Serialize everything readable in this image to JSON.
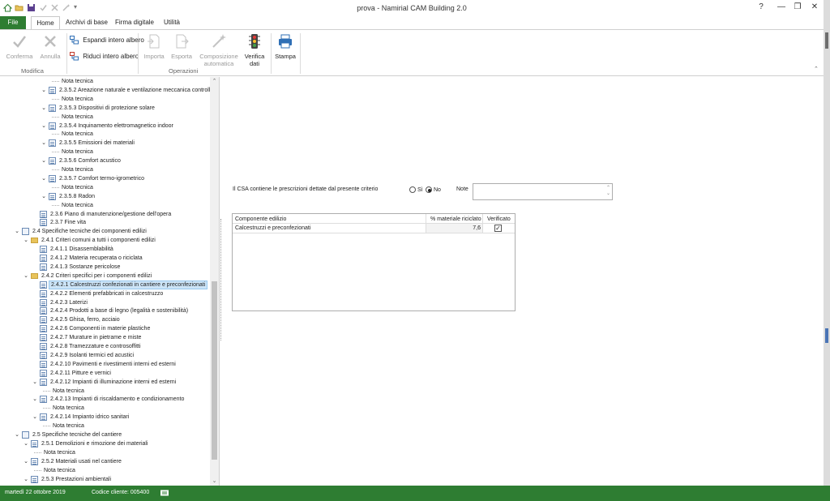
{
  "window": {
    "title": "prova - Namirial CAM Building 2.0",
    "help": "?",
    "minimize": "—",
    "restore": "❐",
    "close": "✕"
  },
  "tabs": [
    "File",
    "Home",
    "Archivi di base",
    "Firma digitale",
    "Utilità"
  ],
  "ribbon": {
    "conferma": "Conferma",
    "annulla": "Annulla",
    "group_modifica": "Modifica",
    "espandi": "Espandi intero albero",
    "riduci": "Riduci intero albero",
    "importa": "Importa",
    "esporta": "Esporta",
    "composizione1": "Composizione",
    "composizione2": "automatica",
    "verifica1": "Verifica",
    "verifica2": "dati",
    "stampa": "Stampa",
    "group_operazioni": "Operazioni"
  },
  "tree": [
    {
      "level": 4,
      "toggle": "",
      "icon": "none",
      "label": "Nota tecnica"
    },
    {
      "level": 3,
      "toggle": "v",
      "icon": "doc",
      "label": "2.3.5.2 Areazione naturale e ventilazione meccanica controllata"
    },
    {
      "level": 4,
      "toggle": "",
      "icon": "none",
      "label": "Nota tecnica"
    },
    {
      "level": 3,
      "toggle": "v",
      "icon": "doc",
      "label": "2.3.5.3 Dispositivi di protezione solare"
    },
    {
      "level": 4,
      "toggle": "",
      "icon": "none",
      "label": "Nota tecnica"
    },
    {
      "level": 3,
      "toggle": "v",
      "icon": "doc",
      "label": "2.3.5.4 Inquinamento elettromagnetico indoor"
    },
    {
      "level": 4,
      "toggle": "",
      "icon": "none",
      "label": "Nota tecnica"
    },
    {
      "level": 3,
      "toggle": "v",
      "icon": "doc",
      "label": "2.3.5.5 Emissioni dei materiali"
    },
    {
      "level": 4,
      "toggle": "",
      "icon": "none",
      "label": "Nota tecnica"
    },
    {
      "level": 3,
      "toggle": "v",
      "icon": "doc",
      "label": "2.3.5.6 Comfort acustico"
    },
    {
      "level": 4,
      "toggle": "",
      "icon": "none",
      "label": "Nota tecnica"
    },
    {
      "level": 3,
      "toggle": "v",
      "icon": "doc",
      "label": "2.3.5.7 Comfort termo-igrometrico"
    },
    {
      "level": 4,
      "toggle": "",
      "icon": "none",
      "label": "Nota tecnica"
    },
    {
      "level": 3,
      "toggle": "v",
      "icon": "doc",
      "label": "2.3.5.8 Radon"
    },
    {
      "level": 4,
      "toggle": "",
      "icon": "none",
      "label": "Nota tecnica"
    },
    {
      "level": 2,
      "toggle": "",
      "icon": "doc",
      "label": "2.3.6 Piano di manutenzione/gestione dell'opera"
    },
    {
      "level": 2,
      "toggle": "",
      "icon": "doc",
      "label": "2.3.7 Fine vita"
    },
    {
      "level": 0,
      "toggle": "v",
      "icon": "sec",
      "label": "2.4 Specifiche tecniche dei componenti edilizi"
    },
    {
      "level": 1,
      "toggle": "v",
      "icon": "folder",
      "label": "2.4.1 Criteri comuni a tutti i componenti edilizi"
    },
    {
      "level": 2,
      "toggle": "",
      "icon": "doc",
      "label": "2.4.1.1 Disassemblabilità"
    },
    {
      "level": 2,
      "toggle": "",
      "icon": "doc",
      "label": "2.4.1.2 Materia recuperata o riciclata"
    },
    {
      "level": 2,
      "toggle": "",
      "icon": "doc",
      "label": "2.4.1.3 Sostanze pericolose"
    },
    {
      "level": 1,
      "toggle": "v",
      "icon": "folder",
      "label": "2.4.2 Criteri specifici per i componenti edilizi"
    },
    {
      "level": 2,
      "toggle": "",
      "icon": "doc",
      "label": "2.4.2.1 Calcestruzzi confezionati in cantiere e preconfezionati",
      "selected": true
    },
    {
      "level": 2,
      "toggle": "",
      "icon": "doc",
      "label": "2.4.2.2 Elementi prefabbricati in calcestruzzo"
    },
    {
      "level": 2,
      "toggle": "",
      "icon": "doc",
      "label": "2.4.2.3 Laterizi"
    },
    {
      "level": 2,
      "toggle": "",
      "icon": "doc",
      "label": "2.4.2.4 Prodotti a base di legno (legalità e sostenibilità)"
    },
    {
      "level": 2,
      "toggle": "",
      "icon": "doc",
      "label": "2.4.2.5 Ghisa, ferro, acciaio"
    },
    {
      "level": 2,
      "toggle": "",
      "icon": "doc",
      "label": "2.4.2.6 Componenti in materie plastiche"
    },
    {
      "level": 2,
      "toggle": "",
      "icon": "doc",
      "label": "2.4.2.7 Murature in pietrame e miste"
    },
    {
      "level": 2,
      "toggle": "",
      "icon": "doc",
      "label": "2.4.2.8 Tramezzature e controsoffitti"
    },
    {
      "level": 2,
      "toggle": "",
      "icon": "doc",
      "label": "2.4.2.9 Isolanti termici ed acustici"
    },
    {
      "level": 2,
      "toggle": "",
      "icon": "doc",
      "label": "2.4.2.10 Pavimenti e rivestimenti interni ed esterni"
    },
    {
      "level": 2,
      "toggle": "",
      "icon": "doc",
      "label": "2.4.2.11 Pitture e vernici"
    },
    {
      "level": 2,
      "toggle": "v",
      "icon": "doc",
      "label": "2.4.2.12 Impianti di illuminazione interni ed esterni"
    },
    {
      "level": 3,
      "toggle": "",
      "icon": "none",
      "label": "Nota tecnica"
    },
    {
      "level": 2,
      "toggle": "v",
      "icon": "doc",
      "label": "2.4.2.13 Impianti di riscaldamento e condizionamento"
    },
    {
      "level": 3,
      "toggle": "",
      "icon": "none",
      "label": "Nota tecnica"
    },
    {
      "level": 2,
      "toggle": "v",
      "icon": "doc",
      "label": "2.4.2.14 Impianto idrico sanitari"
    },
    {
      "level": 3,
      "toggle": "",
      "icon": "none",
      "label": "Nota tecnica"
    },
    {
      "level": 0,
      "toggle": "v",
      "icon": "sec",
      "label": "2.5 Specifiche tecniche del cantiere"
    },
    {
      "level": 1,
      "toggle": "v",
      "icon": "doc",
      "label": "2.5.1 Demolizioni e rimozione dei materiali"
    },
    {
      "level": 2,
      "toggle": "",
      "icon": "none",
      "label": "Nota tecnica"
    },
    {
      "level": 1,
      "toggle": "v",
      "icon": "doc",
      "label": "2.5.2 Materiali usati nel cantiere"
    },
    {
      "level": 2,
      "toggle": "",
      "icon": "none",
      "label": "Nota tecnica"
    },
    {
      "level": 1,
      "toggle": "v",
      "icon": "doc",
      "label": "2.5.3 Prestazioni ambientali"
    }
  ],
  "detail": {
    "question": "Il CSA contiene le prescrizioni dettate dal presente criterio",
    "yes_label": "Sì",
    "no_label": "No",
    "selected": "No",
    "note_label": "Note",
    "note_value": ""
  },
  "grid": {
    "headers": [
      "Componente edilizio",
      "% materiale riciclato",
      "Verificato"
    ],
    "rows": [
      {
        "componente": "Calcestruzzi e preconfezionati",
        "percentuale": "7,6",
        "verificato": true
      }
    ]
  },
  "status": {
    "date": "martedì 22 ottobre 2019",
    "client": "Codice cliente: 005400"
  },
  "colors": {
    "accent": "#2e7d32",
    "selection": "#cce4f7"
  }
}
